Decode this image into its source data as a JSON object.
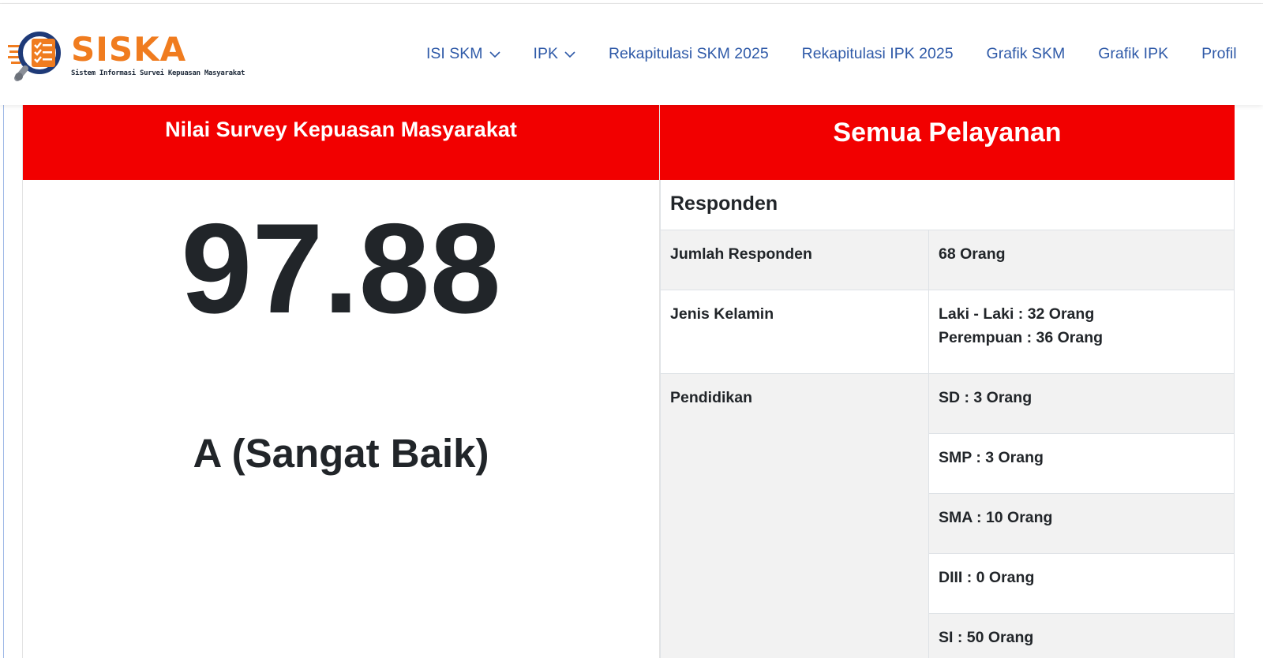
{
  "header": {
    "logo": {
      "title": "SISKA",
      "subtitle": "Sistem Informasi Survei Kepuasan Masyarakat"
    },
    "nav": [
      {
        "label": "ISI SKM",
        "dropdown": true
      },
      {
        "label": "IPK",
        "dropdown": true
      },
      {
        "label": "Rekapitulasi SKM 2025",
        "dropdown": false
      },
      {
        "label": "Rekapitulasi IPK 2025",
        "dropdown": false
      },
      {
        "label": "Grafik SKM",
        "dropdown": false
      },
      {
        "label": "Grafik IPK",
        "dropdown": false
      },
      {
        "label": "Profil",
        "dropdown": false
      }
    ]
  },
  "left": {
    "title": "Nilai Survey Kepuasan Masyarakat",
    "score": "97.88",
    "grade": "A (Sangat Baik)"
  },
  "right": {
    "title": "Semua Pelayanan",
    "section_title": "Responden",
    "jumlah": {
      "label": "Jumlah Responden",
      "value": "68 Orang"
    },
    "jenis_kelamin": {
      "label": "Jenis Kelamin",
      "male": "Laki - Laki : 32 Orang",
      "female": "Perempuan : 36 Orang"
    },
    "pendidikan": {
      "label": "Pendidikan",
      "items": [
        "SD : 3 Orang",
        "SMP : 3 Orang",
        "SMA : 10 Orang",
        "DIII : 0 Orang",
        "SI : 50 Orang"
      ]
    }
  },
  "colors": {
    "accent_red": "#f20000",
    "nav_blue": "#2f5aa8",
    "logo_orange": "#f07c1f",
    "row_grey": "#f2f2f2"
  },
  "icons": {
    "dropdown": "chevron-down-icon",
    "logo": "magnifier-checklist-icon"
  }
}
